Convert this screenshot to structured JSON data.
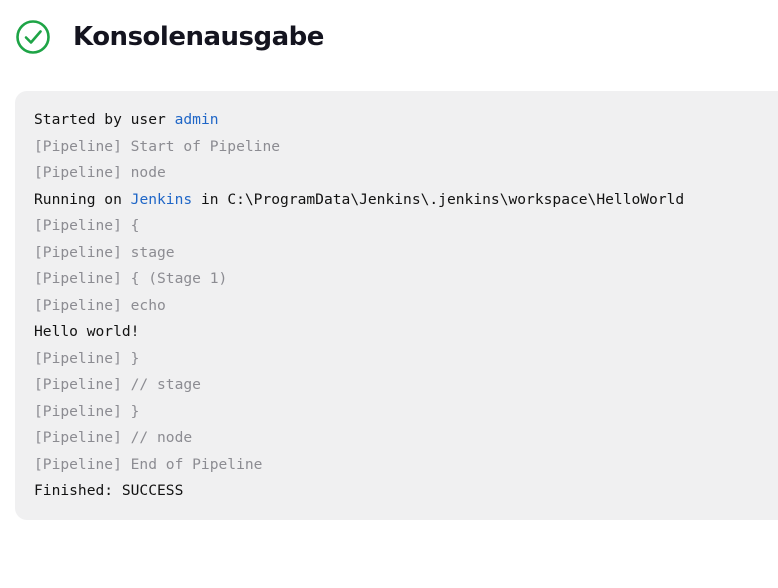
{
  "header": {
    "title": "Konsolenausgabe",
    "status_icon": "success-check-circle-icon",
    "status_color": "#1ea446"
  },
  "colors": {
    "console_background": "#f0f0f1",
    "pipeline_text": "#8c8c92",
    "normal_text": "#121212",
    "link": "#1f66c7"
  },
  "console": {
    "lines": [
      {
        "type": "normal",
        "parts": [
          {
            "text": "Started by user "
          },
          {
            "text": "admin",
            "link": true
          }
        ]
      },
      {
        "type": "pipeline",
        "parts": [
          {
            "text": "[Pipeline] Start of Pipeline"
          }
        ]
      },
      {
        "type": "pipeline",
        "parts": [
          {
            "text": "[Pipeline] node"
          }
        ]
      },
      {
        "type": "normal",
        "parts": [
          {
            "text": "Running on "
          },
          {
            "text": "Jenkins",
            "link": true
          },
          {
            "text": " in C:\\ProgramData\\Jenkins\\.jenkins\\workspace\\HelloWorld"
          }
        ]
      },
      {
        "type": "pipeline",
        "parts": [
          {
            "text": "[Pipeline] {"
          }
        ]
      },
      {
        "type": "pipeline",
        "parts": [
          {
            "text": "[Pipeline] stage"
          }
        ]
      },
      {
        "type": "pipeline",
        "parts": [
          {
            "text": "[Pipeline] { (Stage 1)"
          }
        ]
      },
      {
        "type": "pipeline",
        "parts": [
          {
            "text": "[Pipeline] echo"
          }
        ]
      },
      {
        "type": "normal",
        "parts": [
          {
            "text": "Hello world!"
          }
        ]
      },
      {
        "type": "pipeline",
        "parts": [
          {
            "text": "[Pipeline] }"
          }
        ]
      },
      {
        "type": "pipeline",
        "parts": [
          {
            "text": "[Pipeline] // stage"
          }
        ]
      },
      {
        "type": "pipeline",
        "parts": [
          {
            "text": "[Pipeline] }"
          }
        ]
      },
      {
        "type": "pipeline",
        "parts": [
          {
            "text": "[Pipeline] // node"
          }
        ]
      },
      {
        "type": "pipeline",
        "parts": [
          {
            "text": "[Pipeline] End of Pipeline"
          }
        ]
      },
      {
        "type": "normal",
        "parts": [
          {
            "text": "Finished: SUCCESS"
          }
        ]
      }
    ]
  }
}
